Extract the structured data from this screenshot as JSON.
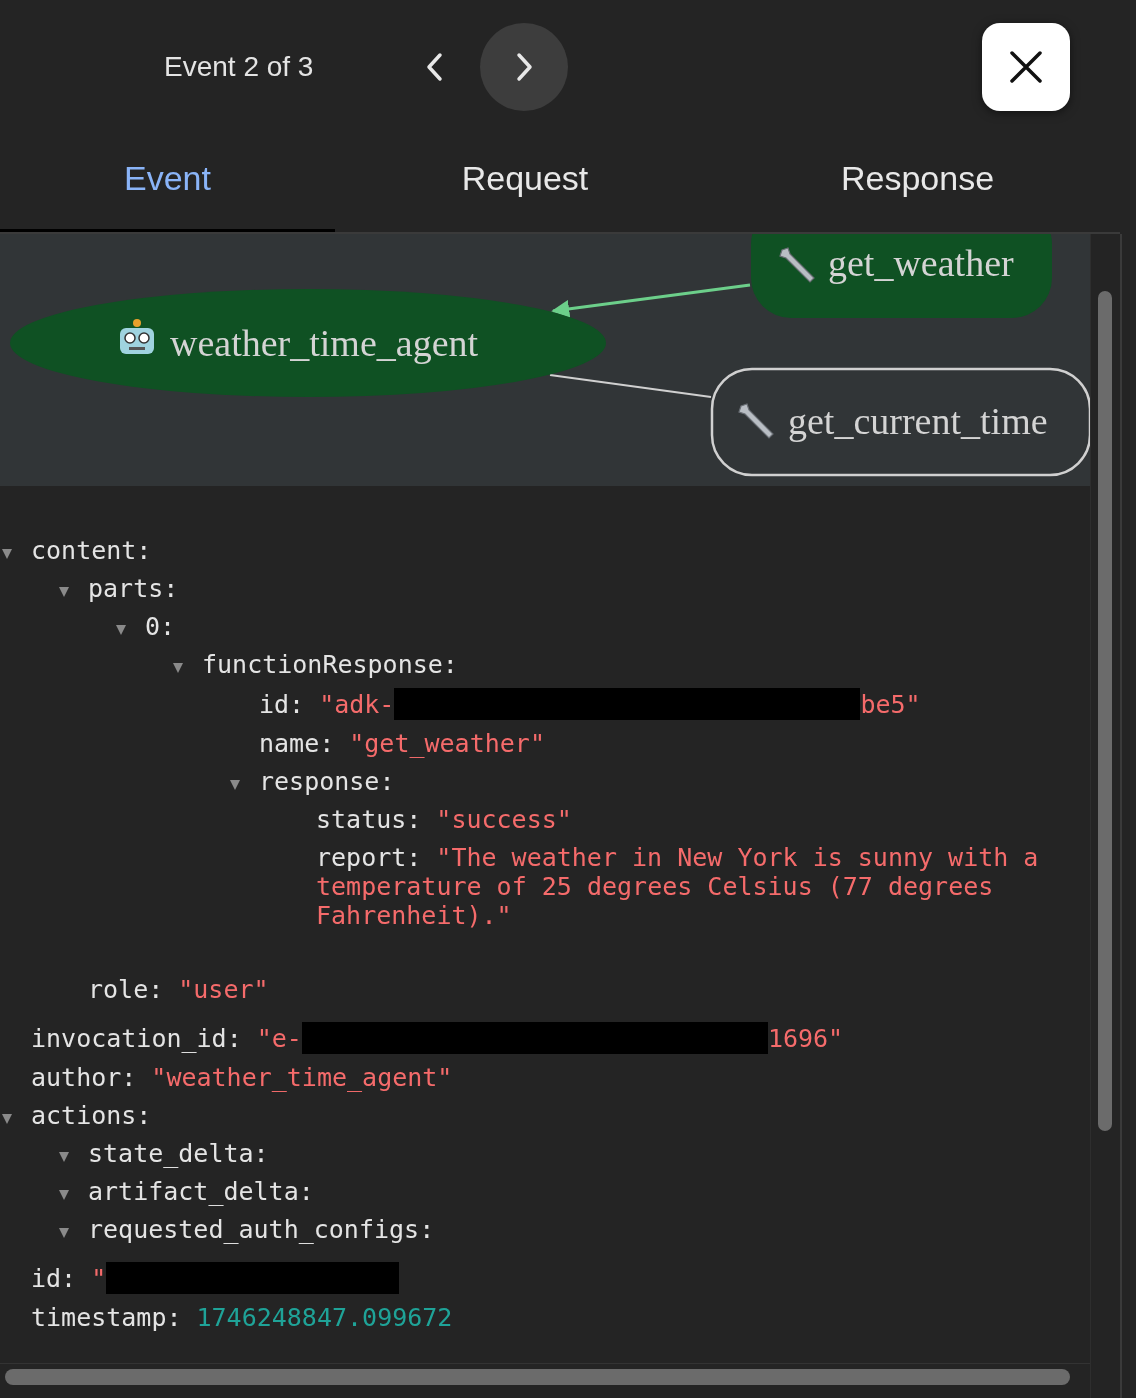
{
  "header": {
    "counter": "Event 2 of 3",
    "next_hovered": true
  },
  "tabs": [
    {
      "label": "Event",
      "selected": true
    },
    {
      "label": "Request",
      "selected": false
    },
    {
      "label": "Response",
      "selected": false
    }
  ],
  "graph": {
    "nodes": [
      {
        "label": "weather_time_agent",
        "kind": "agent",
        "highlighted": true
      },
      {
        "label": "get_weather",
        "kind": "tool",
        "highlighted": true
      },
      {
        "label": "get_current_time",
        "kind": "tool",
        "highlighted": false
      }
    ],
    "edges": [
      {
        "active": true
      },
      {
        "active": false
      }
    ]
  },
  "tree": [
    {
      "key": "content:",
      "expanded": true,
      "children": [
        {
          "key": "parts:",
          "expanded": true,
          "children": [
            {
              "key": "0:",
              "expanded": true,
              "children": [
                {
                  "key": "functionResponse:",
                  "expanded": true,
                  "children": [
                    {
                      "key": "id:",
                      "kind": "string",
                      "value": "\"adk-",
                      "redacted": true,
                      "value_end": "be5\""
                    },
                    {
                      "key": "name:",
                      "kind": "string",
                      "value": "\"get_weather\""
                    },
                    {
                      "key": "response:",
                      "expanded": true,
                      "children": [
                        {
                          "key": "status:",
                          "kind": "string",
                          "value": "\"success\""
                        },
                        {
                          "key": "report:",
                          "kind": "string",
                          "value": "\"The weather in New York is sunny with a temperature of 25 degrees Celsius (77 degrees Fahrenheit).\""
                        }
                      ]
                    }
                  ]
                }
              ]
            }
          ]
        },
        {
          "key": "role:",
          "kind": "string",
          "value": "\"user\""
        }
      ]
    },
    {
      "key": "invocation_id:",
      "kind": "string",
      "value": "\"e-",
      "redacted": true,
      "value_end": "1696\""
    },
    {
      "key": "author:",
      "kind": "string",
      "value": "\"weather_time_agent\""
    },
    {
      "key": "actions:",
      "expanded": true,
      "children": [
        {
          "key": "state_delta:",
          "expanded": true
        },
        {
          "key": "artifact_delta:",
          "expanded": true
        },
        {
          "key": "requested_auth_configs:",
          "expanded": true
        }
      ]
    },
    {
      "key": "id:",
      "kind": "string",
      "value": "\"",
      "redacted": true
    },
    {
      "key": "timestamp:",
      "kind": "number",
      "value": "1746248847.099672"
    }
  ]
}
